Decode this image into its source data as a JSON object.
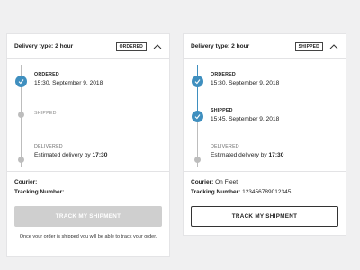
{
  "left_card": {
    "title": "Delivery type: 2 hour",
    "badge": "ORDERED",
    "steps": [
      {
        "label": "ORDERED",
        "value": "15:30. September 9, 2018"
      },
      {
        "label": "SHIPPED"
      },
      {
        "label": "DELIVERED",
        "value_prefix": "Estimated delivery by ",
        "value_strong": "17:30"
      }
    ],
    "courier_label": "Courier:",
    "courier_value": "",
    "tracking_label": "Tracking Number:",
    "tracking_value": "",
    "button_label": "TRACK MY SHIPMENT",
    "hint": "Once your order is shipped you will be able to track your order."
  },
  "right_card": {
    "title": "Delivery type: 2 hour",
    "badge": "SHIPPED",
    "steps": [
      {
        "label": "ORDERED",
        "value": "15:30. September 9, 2018"
      },
      {
        "label": "SHIPPED",
        "value": "15:45. September 9, 2018"
      },
      {
        "label": "DELIVERED",
        "value_prefix": "Estimated delivery by ",
        "value_strong": "17:30"
      }
    ],
    "courier_label": "Courier:",
    "courier_value": "On Fleet",
    "tracking_label": "Tracking Number:",
    "tracking_value": "123456789012345",
    "button_label": "TRACK MY SHIPMENT"
  },
  "icons": {
    "check": "check-icon",
    "collapse": "chevron-up-icon"
  },
  "colors": {
    "accent": "#3f8fbf",
    "inactive": "#bdbdbd",
    "disabled_button": "#cfcfcf"
  }
}
